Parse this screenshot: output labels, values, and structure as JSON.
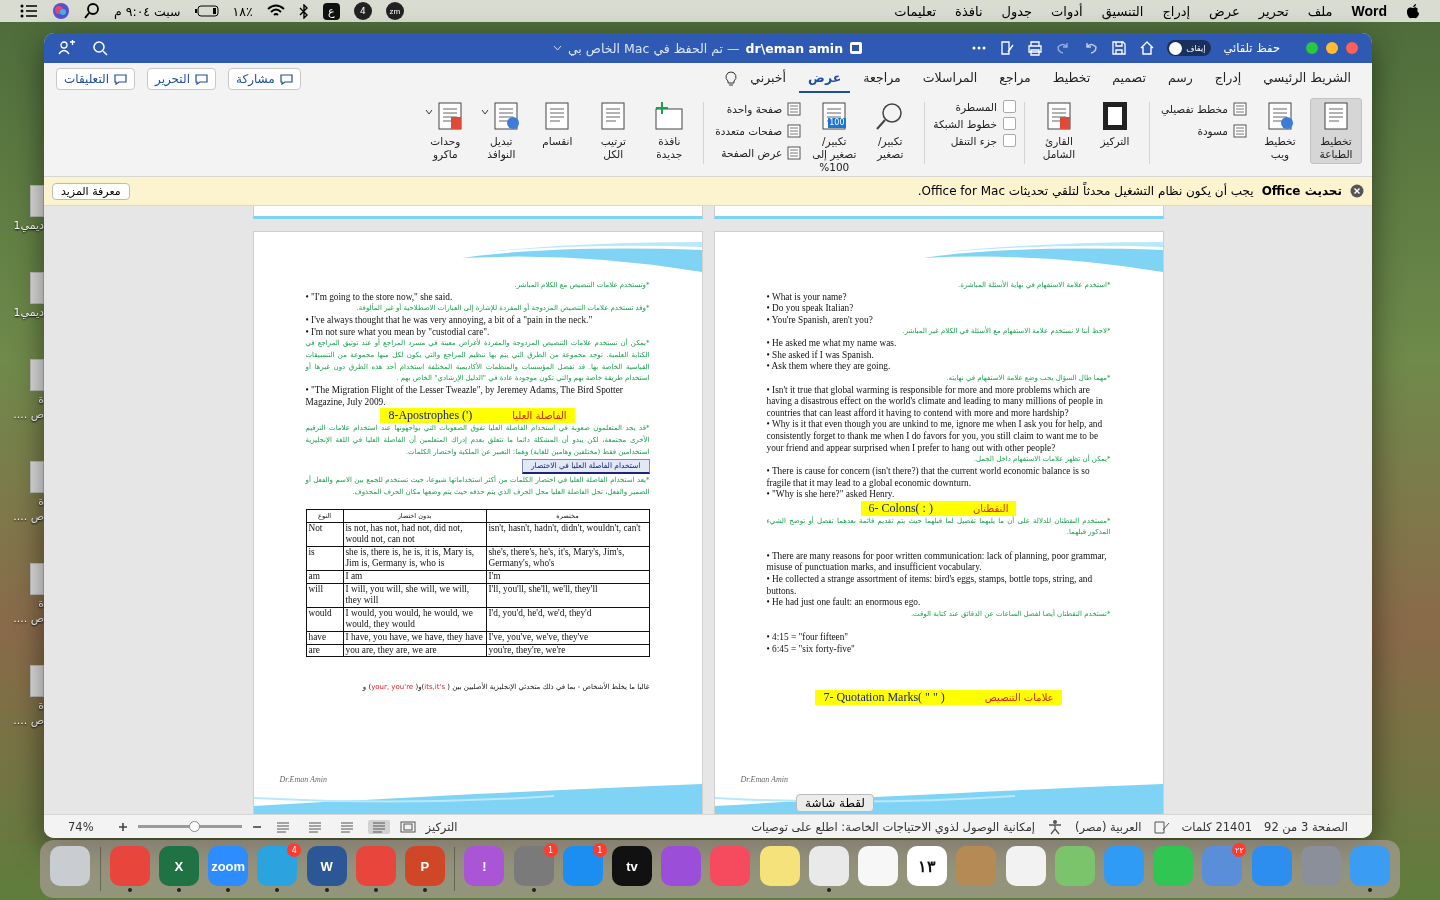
{
  "menu_bar": {
    "app": "Word",
    "items": [
      "ملف",
      "تحرير",
      "عرض",
      "إدراج",
      "التنسيق",
      "أدوات",
      "جدول",
      "نافذة",
      "تعليمات"
    ],
    "input_source": "ع",
    "app_badge": "4",
    "zoom_label": "zm",
    "battery": "٪١٨",
    "clock": "سبت ٩:٠٤ م"
  },
  "desktop_icons": [
    {
      "lines": [
        "ديمي1"
      ]
    },
    {
      "lines": [
        "ديمي1"
      ]
    },
    {
      "lines": [
        "ة",
        "ص ...."
      ]
    },
    {
      "lines": [
        "ة",
        "ص ...."
      ]
    },
    {
      "lines": [
        "ة",
        "ص ...."
      ]
    },
    {
      "lines": [
        "ة",
        "ص ...."
      ]
    }
  ],
  "window": {
    "document_name": "dr\\eman amin",
    "save_status": "— تم الحفظ في Mac الخاص بي",
    "autosave_label": "حفظ تلقائي",
    "autosave_toggle": {
      "label": "إيقاف",
      "on": false
    }
  },
  "tabs": [
    {
      "label": "الشريط الرئيسي",
      "selected": false
    },
    {
      "label": "إدراج",
      "selected": false
    },
    {
      "label": "رسم",
      "selected": false
    },
    {
      "label": "تصميم",
      "selected": false
    },
    {
      "label": "تخطيط",
      "selected": false
    },
    {
      "label": "مراجع",
      "selected": false
    },
    {
      "label": "المراسلات",
      "selected": false
    },
    {
      "label": "مراجعة",
      "selected": false
    },
    {
      "label": "عرض",
      "selected": true
    },
    {
      "label": "أخبرني",
      "selected": false
    }
  ],
  "share_buttons": [
    "مشاركة",
    "التحرير",
    "التعليقات"
  ],
  "ribbon": {
    "groups": [
      {
        "buttons": [
          {
            "label": "تخطيط الطباعة",
            "selected": true
          },
          {
            "label": "تخطيط ويب",
            "selected": false
          }
        ],
        "options": [
          {
            "kind": "small",
            "label": "مخطط تفصيلي",
            "selected": false
          },
          {
            "kind": "small",
            "label": "مسودة",
            "selected": false
          }
        ]
      },
      {
        "buttons": [
          {
            "label": "التركيز"
          },
          {
            "label": "القارئ الشامل"
          }
        ]
      },
      {
        "options": [
          {
            "kind": "check",
            "label": "المسطرة",
            "checked": false
          },
          {
            "kind": "check",
            "label": "خطوط الشبكة",
            "checked": false
          },
          {
            "kind": "check",
            "label": "جزء التنقل",
            "checked": false
          }
        ]
      },
      {
        "buttons": [
          {
            "label": "تكبير/تصغير"
          },
          {
            "label": "تكبير/تصغير إلى 100%",
            "icon_text": "100"
          }
        ],
        "options": [
          {
            "kind": "small",
            "label": "صفحة واحدة"
          },
          {
            "kind": "small",
            "label": "صفحات متعددة"
          },
          {
            "kind": "small",
            "label": "عرض الصفحة"
          }
        ]
      },
      {
        "buttons": [
          {
            "label": "نافذة جديدة"
          },
          {
            "label": "ترتيب الكل"
          },
          {
            "label": "انقسام"
          },
          {
            "label": "تبديل النوافذ",
            "dropdown": true
          },
          {
            "label": "وحدات ماكرو",
            "dropdown": true
          }
        ]
      }
    ]
  },
  "notice": {
    "title": "تحديث Office",
    "message": "يجب أن يكون نظام التشغيل محدثاً لتلقي تحديثات Office for Mac.",
    "button": "معرفة المزيد"
  },
  "pages": [
    {
      "footer": "Dr.Eman Amin",
      "blocks": [
        {
          "kind": "arabic",
          "text": "*استخدم علامة الاستفهام في نهاية الأسئلة المباشرة."
        },
        {
          "kind": "bullet",
          "text": "• What is your name?"
        },
        {
          "kind": "bullet",
          "text": "•  Do you speak Italian?"
        },
        {
          "kind": "bullet",
          "text": "• You're Spanish, aren't you?"
        },
        {
          "kind": "arabic",
          "text": "*لاحظ أننا لا نستخدم علامة الاستفهام مع الأسئلة في الكلام غير المباشر."
        },
        {
          "kind": "bullet",
          "text": "• He asked me what my name was."
        },
        {
          "kind": "bullet",
          "text": "• She asked if I was Spanish."
        },
        {
          "kind": "bullet",
          "text": "• Ask them where they are going."
        },
        {
          "kind": "arabic",
          "text": "*مهما طال السؤال يجب وضع علامة الاستفهام في نهايته."
        },
        {
          "kind": "bullet",
          "text": "• Isn't it true that global warming is responsible for more and more problems which are having a disastrous effect on the world's climate and leading to many millions of people in countries that can least afford it having to contend with more and more hardship?"
        },
        {
          "kind": "bullet",
          "text": "• Why is it that even though you are unkind to me, ignore me when I ask you for help, and consistently forget to thank me when I do favors for you, you still claim to want me to be your friend and appear surprised when I prefer to hang out with other people?"
        },
        {
          "kind": "arabic",
          "text": "*يمكن أن تظهر علامات الاستفهام داخل الجمل."
        },
        {
          "kind": "bullet",
          "text": "• There is cause for concern (isn't there?) that the current world economic balance is so fragile that it may lead to a global economic downturn."
        },
        {
          "kind": "bullet",
          "text": "• \"Why is she here?\" asked Henry."
        },
        {
          "kind": "heading",
          "text_en": "6- Colons( : )",
          "text_ar": "النقطتان"
        },
        {
          "kind": "arabic",
          "text": "*مستخدم النقطتان للدلالة على أن ما يليهما تفصيل لما قبلهما حيث يتم تقديم قائمة بعدهما تفصل أو توضح الشيء المذكور قبلهما."
        },
        {
          "kind": "blank"
        },
        {
          "kind": "bullet",
          "text": "• There are many reasons for poor written communication: lack of planning, poor grammar, misuse of punctuation marks, and insufficient vocabulary."
        },
        {
          "kind": "bullet",
          "text": "• He collected a strange assortment of items: bird's eggs, stamps, bottle tops, string, and buttons."
        },
        {
          "kind": "bullet",
          "text": "• He had just one fault: an enormous ego."
        },
        {
          "kind": "arabic",
          "text": "*تستخدم النقطتان أيضا لفصل الساعات عن الدقائق عند كتابة الوقت."
        },
        {
          "kind": "blank"
        },
        {
          "kind": "bullet",
          "text": "• 4:15 = \"four fifteen\""
        },
        {
          "kind": "bullet",
          "text": "• 6:45 = \"six forty-five\""
        },
        {
          "kind": "blank"
        },
        {
          "kind": "blank"
        },
        {
          "kind": "blank"
        },
        {
          "kind": "heading",
          "text_en": "7- Quotation Marks( \" \" )",
          "text_ar": "علامات التنصيص"
        }
      ]
    },
    {
      "footer": "Dr.Eman Amin",
      "blocks": [
        {
          "kind": "arabic",
          "text": "*وتستخدم علامات التنصيص مع الكلام المباشر."
        },
        {
          "kind": "bullet",
          "text": "• \"I'm going to the store now,\" she said."
        },
        {
          "kind": "arabic",
          "text": "*وقد تستخدم علامات التنصيص المزدوجة أو المفردة للإشارة إلى العبارات الاصطلاحية أو غير المألوفة."
        },
        {
          "kind": "bullet",
          "text": "•  I've always thought that he was very annoying, a bit of a \"pain in the neck.\""
        },
        {
          "kind": "bullet",
          "text": "• I'm not sure what you mean by \"custodial care\"."
        },
        {
          "kind": "arabic",
          "text": "*يمكن أن تستخدم علامات التنصيص المزدوجة والمفردة لأغراض معينة في مسرد المراجع أو عند توثيق المراجع في الكتابة العلمية. توجد مجموعة من الطرق التي يتم بها تنظيم المراجع والتي يكون لكل منها مجموعة من التنسيقات القياسية الخاصة بها. قد تفضل المؤسسات والمنظمات الأكاديمية المختلفة استخدام أحد هذه الطرق دون غيرها أو استخدام طريقة خاصة بهم والتي تكون موجودة عادة في \"الدليل الإرشادي\" الخاص بهم ."
        },
        {
          "kind": "bullet",
          "text": "• \"The Migration Flight of the Lesser Tweazle\", by Jeremey Adams, The Bird Spotter Magazine, July 2009."
        },
        {
          "kind": "heading",
          "text_en": "8-Apostrophes (')",
          "text_ar": "الفاصلة العليا"
        },
        {
          "kind": "arabic",
          "text": "*قد يجد المتعلمون صعوبة في استخدام الفاصلة العليا تفوق الصعوبات التي يواجهونها عند استخدام علامات الترقيم الأخرى مجتمعة، لكن يبدو أن المشكلة دائما ما تتعلق بعدم إدراك المتعلمين أن الفاصلة العليا في اللغة الإنجليزية استخدامين فقط (مختلفين وهامين للغاية) وهما: التعبير عن الملكية واختصار الكلمات."
        },
        {
          "kind": "callout",
          "text": "استخدام الفاصلة العليا في الاختصار"
        },
        {
          "kind": "arabic",
          "text": "*يعد استخدام الفاصلة العليا في اختصار الكلمات من أكثر استخداماتها شيوعا، حيث تستخدم للجمع بين الاسم والفعل أو الضمير والفعل، تحل الفاصلة العليا محل الحرف الذي يتم حذفه حيث يتم وضعها مكان الحرف المحذوف."
        },
        {
          "kind": "table",
          "columns": [
            "مختصرة",
            "بدون اختصار",
            "النوع"
          ],
          "rows": [
            [
              "isn't, hasn't, hadn't, didn't, wouldn't, can't",
              "is not, has not, had not, did not, would not, can not",
              "Not"
            ],
            [
              "she's, there's, he's, it's, Mary's, Jim's, Germany's, who's",
              "she is, there is, he is, it is, Mary is, Jim is, Germany is, who is",
              "is"
            ],
            [
              "I'm",
              "I am",
              "am"
            ],
            [
              "I'll, you'll, she'll, we'll, they'll",
              "I will, you will, she will, we will, they will",
              "will"
            ],
            [
              "I'd, you'd, he'd, we'd, they'd",
              "I would, you would, he would, we would, they would",
              "would"
            ],
            [
              "I've, you've, we've, they've",
              "I have, you have, we have, they have",
              "have"
            ],
            [
              "you're, they're, we're",
              "you are, they are, we are",
              "are"
            ]
          ]
        },
        {
          "kind": "blank"
        },
        {
          "kind": "blank"
        },
        {
          "kind": "note",
          "parts": [
            "غالبا ما يخلط الأشخاص - بما في ذلك متحدثي الإنجليزية الأصليين بين ( ",
            "its,it's",
            ")و( ",
            "your, you're",
            ") و"
          ]
        }
      ]
    }
  ],
  "tooltip": "لقطة شاشة",
  "status_bar": {
    "page": "الصفحة 3 من 92",
    "words": "21401 كلمات",
    "language": "العربية (مصر)",
    "accessibility": "إمكانية الوصول لذوي الاحتياجات الخاصة: اطلع على توصيات",
    "focus": "التركيز",
    "view_buttons": [
      {
        "selected": true
      },
      {
        "selected": false
      },
      {
        "selected": false
      },
      {
        "selected": false
      }
    ],
    "zoom_slider": {
      "level": 0.54
    },
    "zoom": "74%"
  },
  "dock": [
    {
      "kind": "app",
      "color": "#3a9cf2",
      "running": true
    },
    {
      "kind": "app",
      "color": "#8a8f99",
      "running": false
    },
    {
      "kind": "app",
      "color": "#2d8ef0",
      "running": false
    },
    {
      "kind": "app",
      "color": "#5b8ed8",
      "badge": "٢٢",
      "running": false
    },
    {
      "kind": "app",
      "color": "#31c553",
      "running": false
    },
    {
      "kind": "app",
      "color": "#2f9bf5",
      "running": false
    },
    {
      "kind": "app",
      "color": "#7cc46b",
      "running": false
    },
    {
      "kind": "app",
      "color": "#f2f2f2",
      "running": false
    },
    {
      "kind": "app",
      "color": "#b58a55",
      "running": false
    },
    {
      "kind": "app",
      "color": "#ffffff",
      "glyph": "١٣",
      "running": false
    },
    {
      "kind": "app",
      "color": "#f7f7f7",
      "running": false
    },
    {
      "kind": "app",
      "color": "#e9e9e9",
      "running": true
    },
    {
      "kind": "app",
      "color": "#f5e27a",
      "running": false
    },
    {
      "kind": "app",
      "color": "#f64b5e",
      "running": false
    },
    {
      "kind": "app",
      "color": "#9b4fd8",
      "running": false
    },
    {
      "kind": "app",
      "color": "#111111",
      "glyph": "tv",
      "running": false
    },
    {
      "kind": "app",
      "color": "#1c8ef2",
      "badge": "1",
      "running": false
    },
    {
      "kind": "app",
      "color": "#7a7a7a",
      "badge": "1",
      "running": true
    },
    {
      "kind": "app",
      "color": "#a955d6",
      "glyph": "!",
      "running": false
    },
    {
      "kind": "separator"
    },
    {
      "kind": "app",
      "color": "#d04727",
      "glyph": "P",
      "running": true
    },
    {
      "kind": "app",
      "color": "#e8453d",
      "running": true
    },
    {
      "kind": "app",
      "color": "#2b5797",
      "glyph": "W",
      "running": true
    },
    {
      "kind": "app",
      "color": "#2aa3de",
      "badge": "4",
      "running": true
    },
    {
      "kind": "app",
      "color": "#2d8cff",
      "glyph": "zoom",
      "running": true
    },
    {
      "kind": "app",
      "color": "#1f7244",
      "glyph": "X",
      "running": true
    },
    {
      "kind": "app",
      "color": "#e8453c",
      "running": true
    },
    {
      "kind": "separator"
    },
    {
      "kind": "app",
      "color": "#c9cdd2",
      "running": false
    }
  ]
}
